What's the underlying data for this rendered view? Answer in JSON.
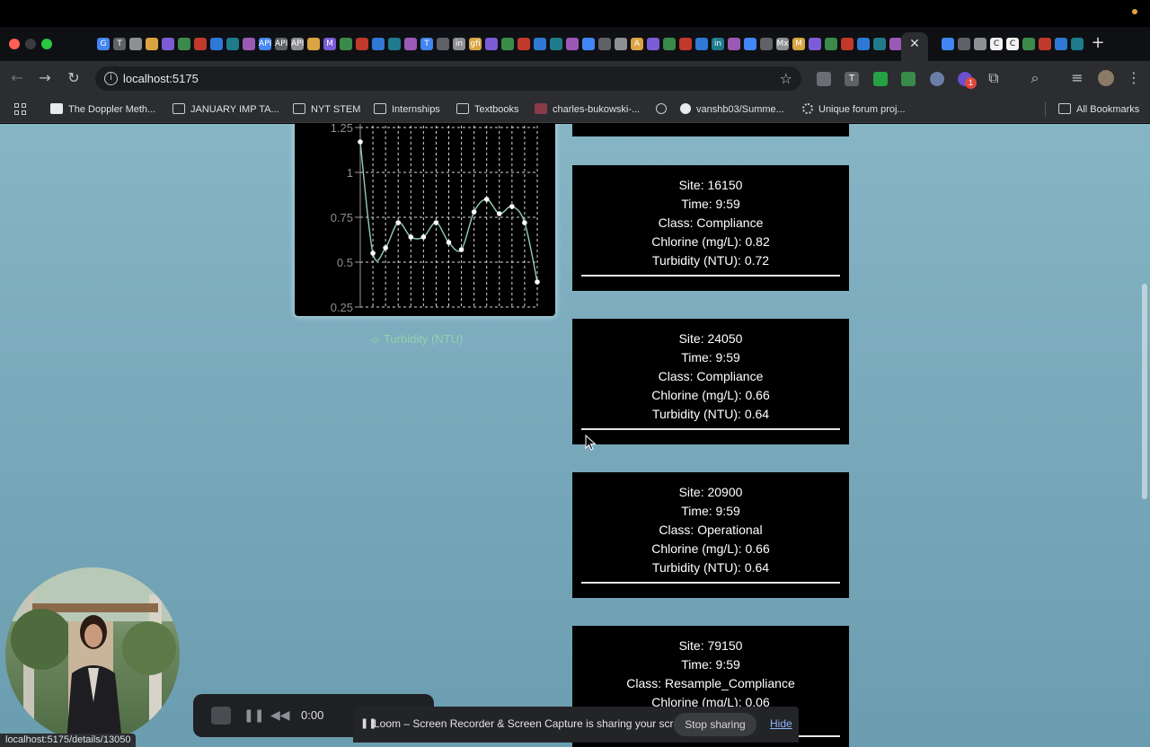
{
  "browser": {
    "url": "localhost:5175",
    "status_url": "localhost:5175/details/13050",
    "extension_badge": "1",
    "tab_favicon_letters": [
      "G",
      "T",
      "",
      "",
      "",
      "",
      "",
      "",
      "",
      "",
      "API",
      "API",
      "API",
      "",
      "M",
      "",
      "",
      "",
      "",
      "",
      "T",
      "",
      "in",
      "gfi",
      "",
      "",
      "",
      "",
      "",
      "",
      "",
      "",
      "",
      "A",
      "",
      "",
      "",
      "",
      "in",
      "",
      "",
      "",
      "Mx",
      "M",
      "",
      "",
      "",
      "",
      "",
      "",
      "",
      "",
      "",
      "C",
      "C",
      "",
      "",
      "",
      "",
      "",
      "",
      ""
    ],
    "bookmarks": [
      {
        "label": "The Doppler Meth...",
        "icon": "page-icon"
      },
      {
        "label": "JANUARY IMP TA...",
        "icon": "folder-icon"
      },
      {
        "label": "NYT STEM",
        "icon": "folder-icon"
      },
      {
        "label": "Internships",
        "icon": "folder-icon"
      },
      {
        "label": "Textbooks",
        "icon": "folder-icon"
      },
      {
        "label": "charles-bukowski-...",
        "icon": "image-icon"
      },
      {
        "label": "",
        "icon": "globe-icon"
      },
      {
        "label": "vanshb03/Summe...",
        "icon": "github-icon"
      },
      {
        "label": "Unique forum proj...",
        "icon": "forum-icon"
      }
    ],
    "all_bookmarks": "All Bookmarks"
  },
  "chart_data": {
    "type": "line",
    "series": [
      {
        "name": "Turbidity (NTU)",
        "color": "#93d0ae",
        "values": [
          1.17,
          0.55,
          0.58,
          0.72,
          0.64,
          0.64,
          0.72,
          0.61,
          0.57,
          0.78,
          0.85,
          0.77,
          0.81,
          0.72,
          0.39
        ]
      }
    ],
    "ylim": [
      0.25,
      1.25
    ],
    "yticks": [
      "0.25",
      "0.5",
      "0.75",
      "1",
      "1.25"
    ],
    "grid": true,
    "legend": "bottom"
  },
  "readings": [
    {
      "site": "Site: 16150",
      "time": "Time: 9:59",
      "class": "Class: Compliance",
      "chlorine": "Chlorine (mg/L): 0.82",
      "turbidity": "Turbidity (NTU): 0.72"
    },
    {
      "site": "Site: 24050",
      "time": "Time: 9:59",
      "class": "Class: Compliance",
      "chlorine": "Chlorine (mg/L): 0.66",
      "turbidity": "Turbidity (NTU): 0.64"
    },
    {
      "site": "Site: 20900",
      "time": "Time: 9:59",
      "class": "Class: Operational",
      "chlorine": "Chlorine (mg/L): 0.66",
      "turbidity": "Turbidity (NTU): 0.64"
    },
    {
      "site": "Site: 79150",
      "time": "Time: 9:59",
      "class": "Class: Resample_Compliance",
      "chlorine": "Chlorine (mg/L): 0.06",
      "turbidity": ""
    }
  ],
  "loom": {
    "time": "0:00",
    "message": "Loom – Screen Recorder & Screen Capture is sharing your screen.",
    "stop_label": "Stop sharing",
    "hide_label": "Hide"
  }
}
